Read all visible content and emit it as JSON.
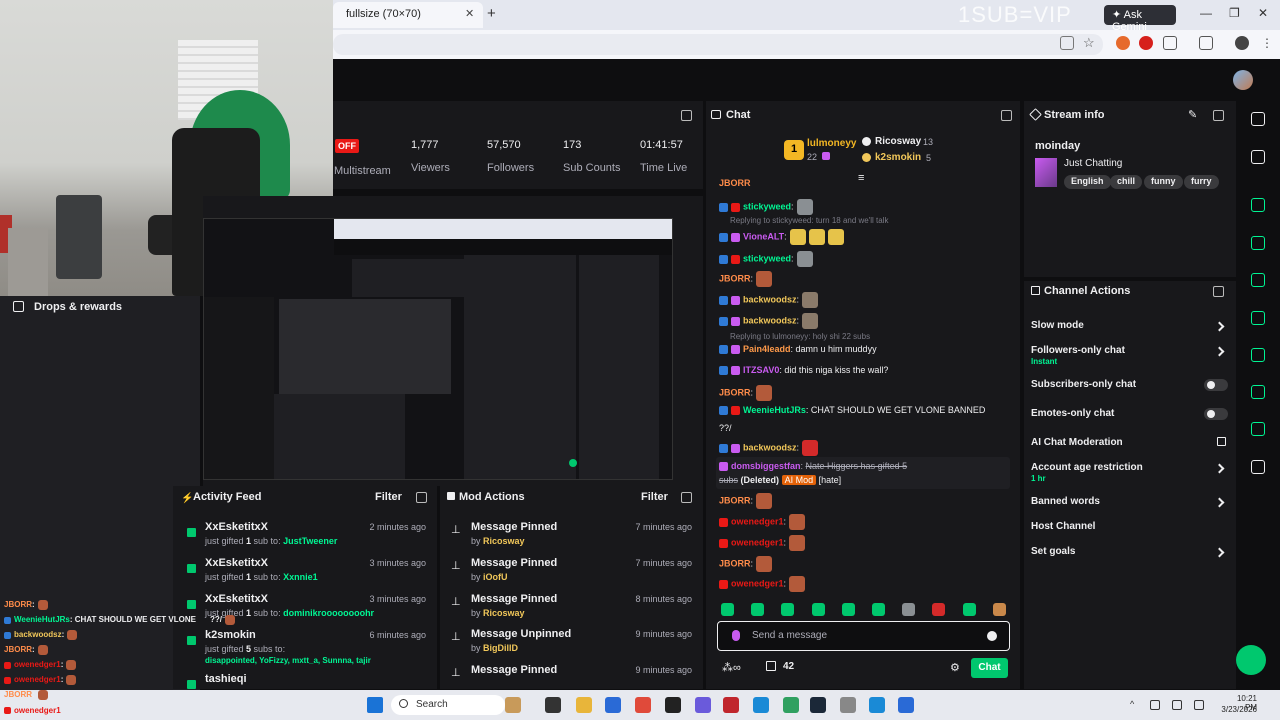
{
  "browser": {
    "tab_title": "fullsize (70×70)",
    "watermark": "1SUB=VIP",
    "ask_gemini": "Ask Gemini"
  },
  "nav": {
    "drops_label": "Drops & rewards"
  },
  "stats": {
    "off_badge": "OFF",
    "multistream_label": "Multistream",
    "viewers_value": "1,777",
    "viewers_label": "Viewers",
    "followers_value": "57,570",
    "followers_label": "Followers",
    "subs_value": "173",
    "subs_label": "Sub Counts",
    "time_value": "01:41:57",
    "time_label": "Time Live"
  },
  "activity_feed": {
    "title": "Activity Feed",
    "filter": "Filter",
    "items": [
      {
        "name": "XxEsketitxX",
        "pre": "just gifted ",
        "count": "1",
        "mid": " sub to: ",
        "target": "JustTweener",
        "time": "2 minutes ago"
      },
      {
        "name": "XxEsketitxX",
        "pre": "just gifted ",
        "count": "1",
        "mid": " sub to: ",
        "target": "Xxnnie1",
        "time": "3 minutes ago"
      },
      {
        "name": "XxEsketitxX",
        "pre": "just gifted ",
        "count": "1",
        "mid": " sub to: ",
        "target": "dominikroooooooohr",
        "time": "3 minutes ago"
      },
      {
        "name": "k2smokin",
        "pre": "just gifted ",
        "count": "5",
        "mid": " subs to:",
        "target": "disappointed, YoFizzy, mxtt_a, Sunnna, tajir",
        "time": "6 minutes ago"
      },
      {
        "name": "tashieqi",
        "pre": "",
        "count": "",
        "mid": "",
        "target": "",
        "time": ""
      }
    ]
  },
  "mod_actions": {
    "title": "Mod Actions",
    "filter": "Filter",
    "items": [
      {
        "action": "Message Pinned",
        "by": "by ",
        "who": "Ricosway",
        "time": "7 minutes ago"
      },
      {
        "action": "Message Pinned",
        "by": "by ",
        "who": "iOofU",
        "time": "7 minutes ago"
      },
      {
        "action": "Message Pinned",
        "by": "by ",
        "who": "Ricosway",
        "time": "8 minutes ago"
      },
      {
        "action": "Message Unpinned",
        "by": "by ",
        "who": "BigDillD",
        "time": "9 minutes ago"
      },
      {
        "action": "Message Pinned",
        "by": "",
        "who": "",
        "time": "9 minutes ago"
      }
    ]
  },
  "chat": {
    "title": "Chat",
    "leaders": [
      {
        "name": "lulmoneyy",
        "count": "22"
      },
      {
        "name": "Ricosway",
        "count": "13"
      },
      {
        "name": "k2smokin",
        "count": "5"
      }
    ],
    "top_cut": "JBORR",
    "messages": [
      {
        "user": "stickyweed",
        "color": "#00f593",
        "text": ":",
        "reply": ""
      },
      {
        "user": "VioneALT",
        "color": "#c95bf0",
        "text": ":",
        "reply": "Replying to stickyweed: turn 18 and we'll talk"
      },
      {
        "user": "stickyweed",
        "color": "#00f593",
        "text": ":",
        "reply": ""
      },
      {
        "user": "JBORR",
        "color": "#ff8c4a",
        "text": ":",
        "reply": ""
      },
      {
        "user": "backwoodsz",
        "color": "#f1c75a",
        "text": ":",
        "reply": ""
      },
      {
        "user": "backwoodsz",
        "color": "#f1c75a",
        "text": ":",
        "reply": ""
      },
      {
        "user": "Pain4leadd",
        "color": "#ff9a4a",
        "text": ": damn u him muddyy",
        "reply": "Replying to lulmoneyy: holy shi 22 subs"
      },
      {
        "user": "ITZSAV0",
        "color": "#c95bf0",
        "text": ": did this niga kiss the wall?",
        "reply": ""
      },
      {
        "user": "JBORR",
        "color": "#ff8c4a",
        "text": ":",
        "reply": ""
      },
      {
        "user": "WeenieHutJRs",
        "color": "#00f593",
        "text": ": CHAT SHOULD WE GET VLONE BANNED",
        "reply": ""
      },
      {
        "user": "backwoodsz",
        "color": "#f1c75a",
        "text": ":",
        "reply": ""
      }
    ],
    "wrap_text": "??/",
    "deleted_user": "domsbiggestfan",
    "deleted_text": "Nate Higgers has gifted 5",
    "deleted_text2": "subs",
    "deleted_tag": "(Deleted)",
    "aimod_tag": "AI Mod",
    "hate_tag": "[hate]",
    "after": [
      {
        "user": "JBORR",
        "color": "#ff8c4a"
      },
      {
        "user": "owenedger1",
        "color": "#e91916"
      },
      {
        "user": "owenedger1",
        "color": "#e91916"
      },
      {
        "user": "JBORR",
        "color": "#ff8c4a"
      },
      {
        "user": "owenedger1",
        "color": "#e91916"
      }
    ],
    "input_placeholder": "Send a message",
    "points": "42",
    "chat_button": "Chat"
  },
  "stream_info": {
    "title": "Stream info",
    "stream_title": "moinday",
    "category": "Just Chatting",
    "tags": [
      "English",
      "chill",
      "funny",
      "furry"
    ]
  },
  "channel_actions": {
    "title": "Channel Actions",
    "items": [
      {
        "label": "Slow mode",
        "sub": "",
        "control": "chevron"
      },
      {
        "label": "Followers-only chat",
        "sub": "Instant",
        "control": "chevron"
      },
      {
        "label": "Subscribers-only chat",
        "sub": "",
        "control": "toggle"
      },
      {
        "label": "Emotes-only chat",
        "sub": "",
        "control": "toggle"
      },
      {
        "label": "AI Chat Moderation",
        "sub": "",
        "control": "link"
      },
      {
        "label": "Account age restriction",
        "sub": "1 hr",
        "control": "chevron"
      },
      {
        "label": "Banned words",
        "sub": "",
        "control": "chevron"
      },
      {
        "label": "Host Channel",
        "sub": "",
        "control": "none"
      },
      {
        "label": "Set goals",
        "sub": "",
        "control": "chevron"
      }
    ]
  },
  "overlay_chat": [
    {
      "user": "JBORR",
      "color": "#ff8c4a",
      "text": ":"
    },
    {
      "user": "WeenieHutJRs",
      "color": "#00f593",
      "text": ": CHAT SHOULD WE GET VLONE",
      "tail": "??/"
    },
    {
      "user": "backwoodsz",
      "color": "#f1c75a",
      "text": ":"
    },
    {
      "user": "JBORR",
      "color": "#ff8c4a",
      "text": ":"
    },
    {
      "user": "owenedger1",
      "color": "#e91916",
      "text": ":"
    },
    {
      "user": "owenedger1",
      "color": "#e91916",
      "text": ":"
    },
    {
      "user": "JBORR",
      "color": "#ff8c4a",
      "text": ":"
    },
    {
      "user": "owenedger1",
      "color": "#e91916",
      "text": ""
    }
  ],
  "taskbar": {
    "search_placeholder": "Search",
    "time": "10:21 PM",
    "date": "3/23/2026"
  }
}
